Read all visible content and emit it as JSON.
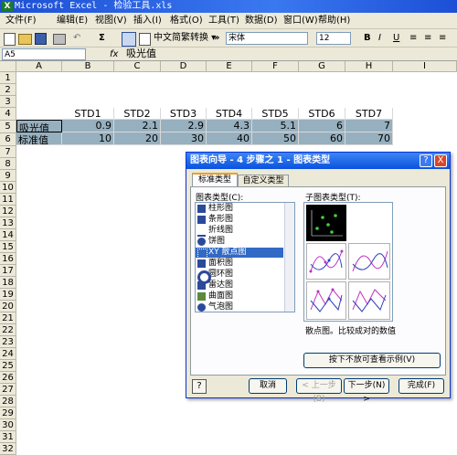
{
  "window": {
    "title": "Microsoft Excel - 检验工具.xls",
    "icon": "excel-icon"
  },
  "menu": [
    "文件(F)",
    "编辑(E)",
    "视图(V)",
    "插入(I)",
    "格式(O)",
    "工具(T)",
    "数据(D)",
    "窗口(W)",
    "帮助(H)"
  ],
  "toolbar": {
    "sigma": "Σ",
    "convert_label": "中文简繁转换 ▾",
    "font": "宋体",
    "font_size": "12",
    "bold": "B",
    "italic": "I",
    "underline": "U"
  },
  "formula": {
    "cell_ref": "A5",
    "fx": "fx",
    "value": "吸光值"
  },
  "columns": [
    "A",
    "B",
    "C",
    "D",
    "E",
    "F",
    "G",
    "H",
    "I"
  ],
  "rows": [
    "1",
    "2",
    "3",
    "4",
    "5",
    "6",
    "7",
    "8",
    "9",
    "10",
    "11",
    "12",
    "13",
    "14",
    "15",
    "16",
    "17",
    "18",
    "19",
    "20",
    "21",
    "22",
    "23",
    "24",
    "25",
    "26",
    "27",
    "28",
    "29",
    "30",
    "31",
    "32"
  ],
  "table": {
    "headers": [
      "STD1",
      "STD2",
      "STD3",
      "STD4",
      "STD5",
      "STD6",
      "STD7"
    ],
    "row5_label": "吸光值",
    "row5": [
      "0.9",
      "2.1",
      "2.9",
      "4.3",
      "5.1",
      "6",
      "7"
    ],
    "row6_label": "标准值",
    "row6": [
      "10",
      "20",
      "30",
      "40",
      "50",
      "60",
      "70"
    ]
  },
  "dialog": {
    "title": "图表向导 - 4 步骤之 1 - 图表类型",
    "help_btn": "?",
    "close_btn": "X",
    "tabs": [
      "标准类型",
      "自定义类型"
    ],
    "chart_type_label": "图表类型(C):",
    "subtype_label": "子图表类型(T):",
    "types": [
      "柱形图",
      "条形图",
      "折线图",
      "饼图",
      "XY 散点图",
      "面积图",
      "圆环图",
      "雷达图",
      "曲面图",
      "气泡图"
    ],
    "description": "散点图。比较成对的数值",
    "preview_btn": "按下不放可查看示例(V)",
    "cancel": "取消",
    "back": "< 上一步(B)",
    "next": "下一步(N) >",
    "finish": "完成(F)"
  }
}
